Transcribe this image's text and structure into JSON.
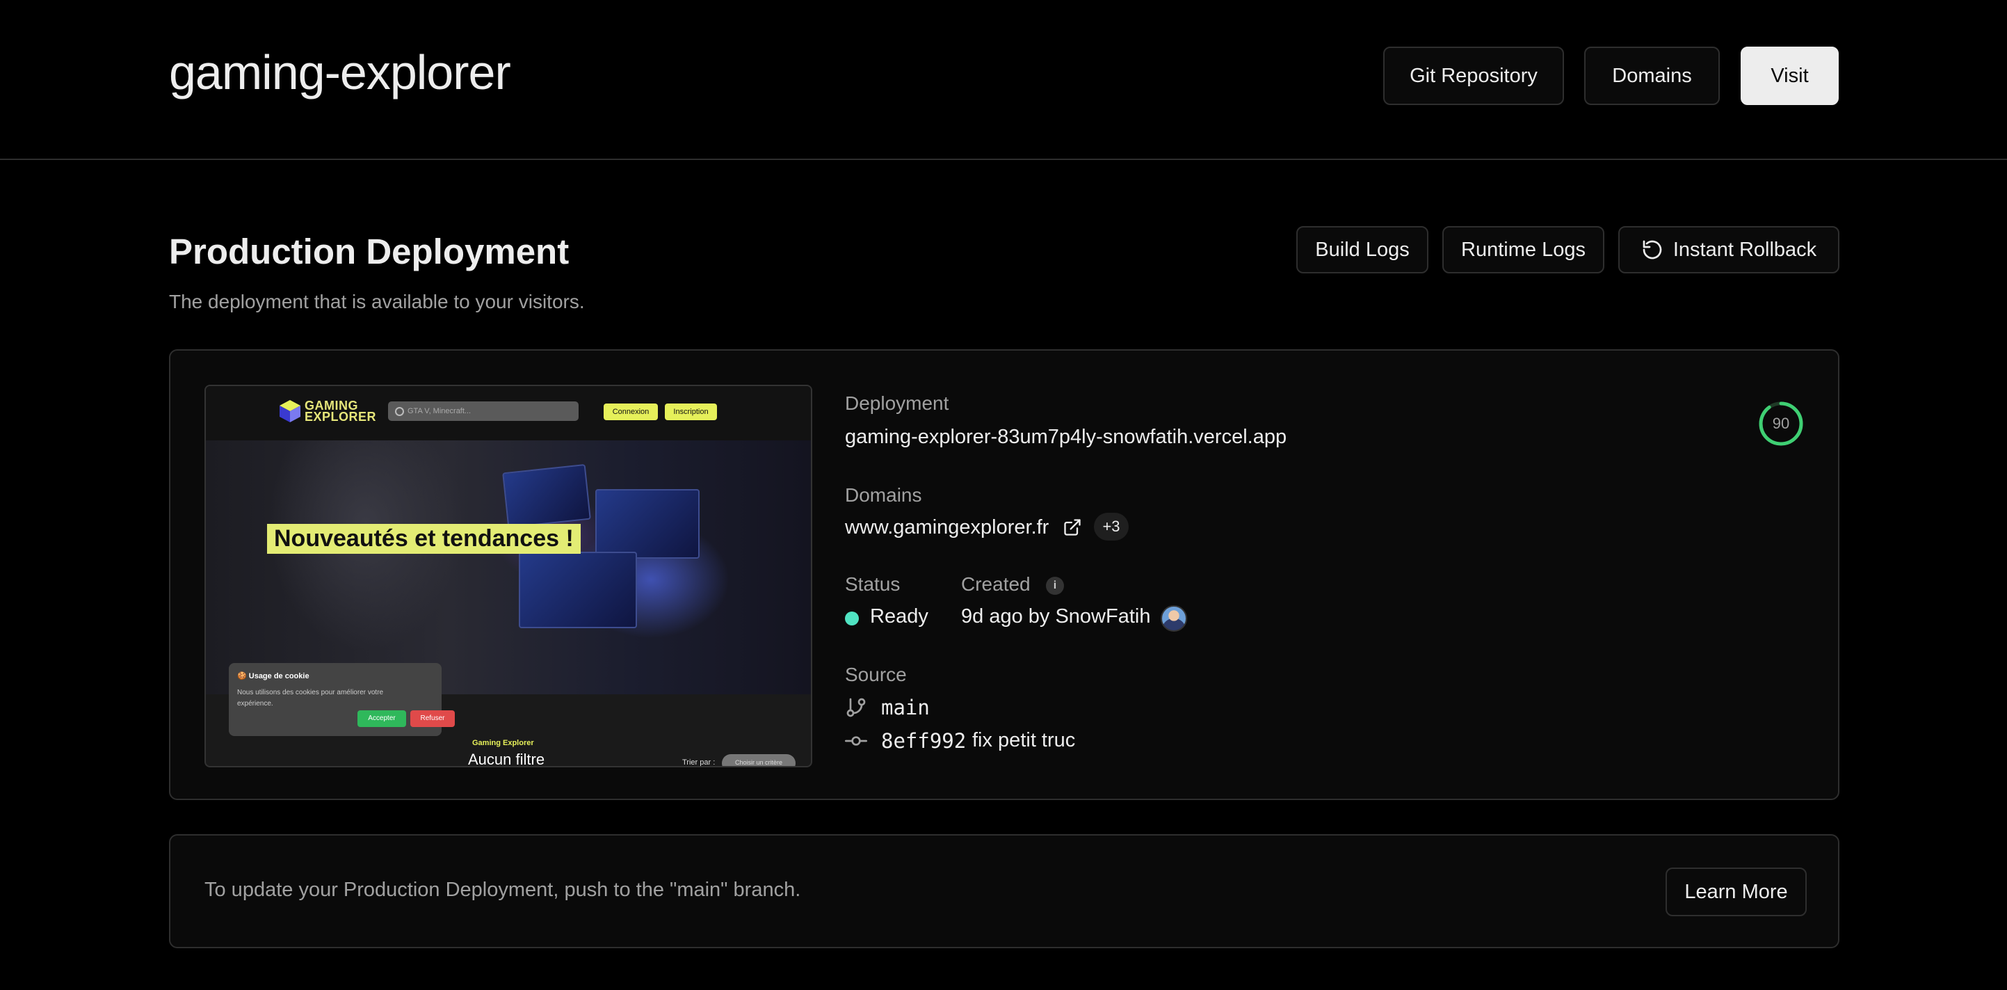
{
  "header": {
    "project_name": "gaming-explorer",
    "git_repository_label": "Git Repository",
    "domains_label": "Domains",
    "visit_label": "Visit"
  },
  "production": {
    "title": "Production Deployment",
    "subtitle": "The deployment that is available to your visitors.",
    "build_logs_label": "Build Logs",
    "runtime_logs_label": "Runtime Logs",
    "instant_rollback_label": "Instant Rollback"
  },
  "preview": {
    "logo_line1": "GAMING",
    "logo_line2": "EXPLORER",
    "search_placeholder": "GTA V, Minecraft...",
    "connexion_label": "Connexion",
    "inscription_label": "Inscription",
    "headline": "Nouveautés et tendances !",
    "cookie_title": "🍪 Usage de cookie",
    "cookie_text": "Nous utilisons des cookies pour améliorer votre expérience.",
    "cookie_accept": "Accepter",
    "cookie_refuse": "Refuser",
    "footer_title": "Gaming Explorer",
    "footer_filter": "Aucun filtre",
    "sort_label": "Trier par :",
    "sort_button": "Choisir un critère"
  },
  "deployment": {
    "deployment_label": "Deployment",
    "deployment_url": "gaming-explorer-83um7p4ly-snowfatih.vercel.app",
    "score": 90,
    "domains_label": "Domains",
    "domain": "www.gamingexplorer.fr",
    "extra_domains": "+3",
    "status_label": "Status",
    "status_value": "Ready",
    "created_label": "Created",
    "created_value": "9d ago by SnowFatih",
    "source_label": "Source",
    "branch": "main",
    "commit_hash": "8eff992",
    "commit_message": "fix petit truc"
  },
  "banner": {
    "text": "To update your Production Deployment, push to the \"main\" branch.",
    "learn_more_label": "Learn More"
  },
  "colors": {
    "background": "#000000",
    "card": "#0a0a0a",
    "border": "#2e2e2e",
    "status_ready": "#50e3c2",
    "score_ring": "#3fcf73"
  },
  "icons": {
    "rollback": "rollback-icon",
    "external_link": "external-link-icon",
    "info": "info-icon",
    "branch": "git-branch-icon",
    "commit": "git-commit-icon"
  }
}
